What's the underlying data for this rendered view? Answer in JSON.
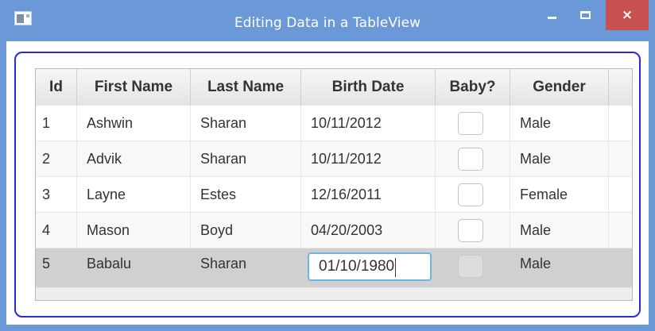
{
  "window": {
    "title": "Editing Data in a TableView",
    "close_glyph": "×"
  },
  "table": {
    "columns": [
      "Id",
      "First Name",
      "Last Name",
      "Birth Date",
      "Baby?",
      "Gender"
    ],
    "rows": [
      {
        "id": "1",
        "first": "Ashwin",
        "last": "Sharan",
        "birth": "10/11/2012",
        "baby": false,
        "gender": "Male"
      },
      {
        "id": "2",
        "first": "Advik",
        "last": "Sharan",
        "birth": "10/11/2012",
        "baby": false,
        "gender": "Male"
      },
      {
        "id": "3",
        "first": "Layne",
        "last": "Estes",
        "birth": "12/16/2011",
        "baby": false,
        "gender": "Female"
      },
      {
        "id": "4",
        "first": "Mason",
        "last": "Boyd",
        "birth": "04/20/2003",
        "baby": false,
        "gender": "Male"
      },
      {
        "id": "5",
        "first": "Babalu",
        "last": "Sharan",
        "birth": "01/10/1980",
        "baby": false,
        "gender": "Male"
      }
    ],
    "editing_value": "01/10/1980"
  },
  "colors": {
    "titlebar": "#6b98d6",
    "close_button": "#c75050",
    "frame_border": "#2a2ad8",
    "edit_focus": "#6cb4e4",
    "selected_row": "#d0d0d0"
  }
}
